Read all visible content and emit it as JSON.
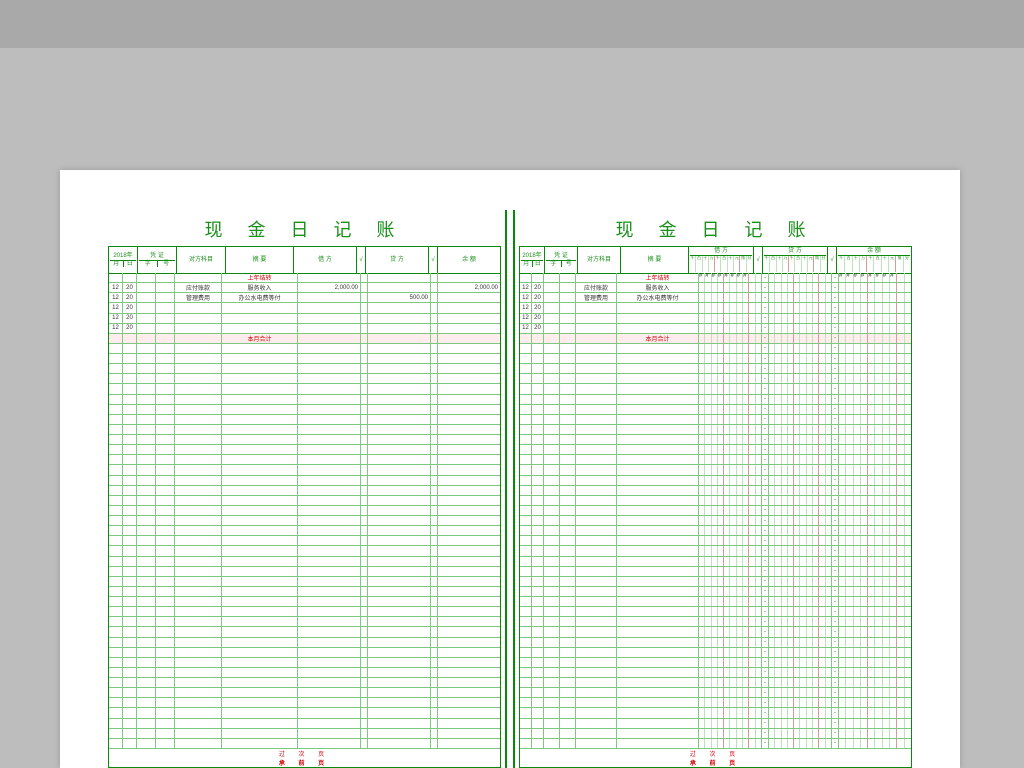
{
  "title": "现 金 日 记 账",
  "year_label": "2018年",
  "header": {
    "month": "月",
    "date": "日",
    "voucher": "凭 证",
    "voucher_type": "字",
    "voucher_no": "号",
    "subject": "对方科目",
    "summary": "摘    要",
    "debit": "借  方",
    "credit": "贷  方",
    "check": "√",
    "balance": "余  额"
  },
  "digit_hdr": [
    "千",
    "百",
    "十",
    "万",
    "千",
    "百",
    "十",
    "元",
    "角",
    "分"
  ],
  "footer": {
    "line1": "过  次  页",
    "line2": "承  前  页"
  },
  "pageA": {
    "rows": [
      {
        "m": "",
        "d": "",
        "vt": "",
        "vn": "",
        "sub": "",
        "sum": "上年结转",
        "red": true,
        "dr": "",
        "cr": "",
        "bal": ""
      },
      {
        "m": "12",
        "d": "20",
        "vt": "",
        "vn": "",
        "sub": "应付账款",
        "sum": "服务收入",
        "dr": "2,000.00",
        "cr": "",
        "bal": "2,000.00"
      },
      {
        "m": "12",
        "d": "20",
        "vt": "",
        "vn": "",
        "sub": "管理费用",
        "sum": "办公水电费等付",
        "dr": "",
        "cr": "500.00",
        "bal": ""
      },
      {
        "m": "12",
        "d": "20"
      },
      {
        "m": "12",
        "d": "20"
      },
      {
        "m": "12",
        "d": "20"
      },
      {
        "m": "",
        "d": "",
        "sum": "本月合计",
        "red": true,
        "hl": true
      },
      {},
      {},
      {},
      {},
      {},
      {},
      {},
      {},
      {},
      {},
      {},
      {},
      {},
      {},
      {},
      {},
      {},
      {},
      {},
      {},
      {},
      {},
      {},
      {},
      {},
      {},
      {},
      {},
      {},
      {},
      {},
      {},
      {},
      {},
      {},
      {},
      {},
      {},
      {},
      {}
    ]
  },
  "pageB": {
    "rows": [
      {
        "m": "",
        "d": "",
        "sub": "",
        "sum": "上年结转",
        "red": true,
        "dr_d": "########",
        "bal_d": "########"
      },
      {
        "m": "12",
        "d": "20",
        "sub": "应付账款",
        "sum": "服务收入",
        "dr_d": "",
        "bal_d": ""
      },
      {
        "m": "12",
        "d": "20",
        "sub": "管理费用",
        "sum": "办公水电费等付"
      },
      {
        "m": "12",
        "d": "20"
      },
      {
        "m": "12",
        "d": "20"
      },
      {
        "m": "12",
        "d": "20"
      },
      {
        "m": "",
        "d": "",
        "sum": "本月合计",
        "red": true,
        "hl": true
      },
      {},
      {},
      {},
      {},
      {},
      {},
      {},
      {},
      {},
      {},
      {},
      {},
      {},
      {},
      {},
      {},
      {},
      {},
      {},
      {},
      {},
      {},
      {},
      {},
      {},
      {},
      {},
      {},
      {},
      {},
      {},
      {},
      {},
      {},
      {},
      {},
      {},
      {},
      {},
      {}
    ]
  }
}
